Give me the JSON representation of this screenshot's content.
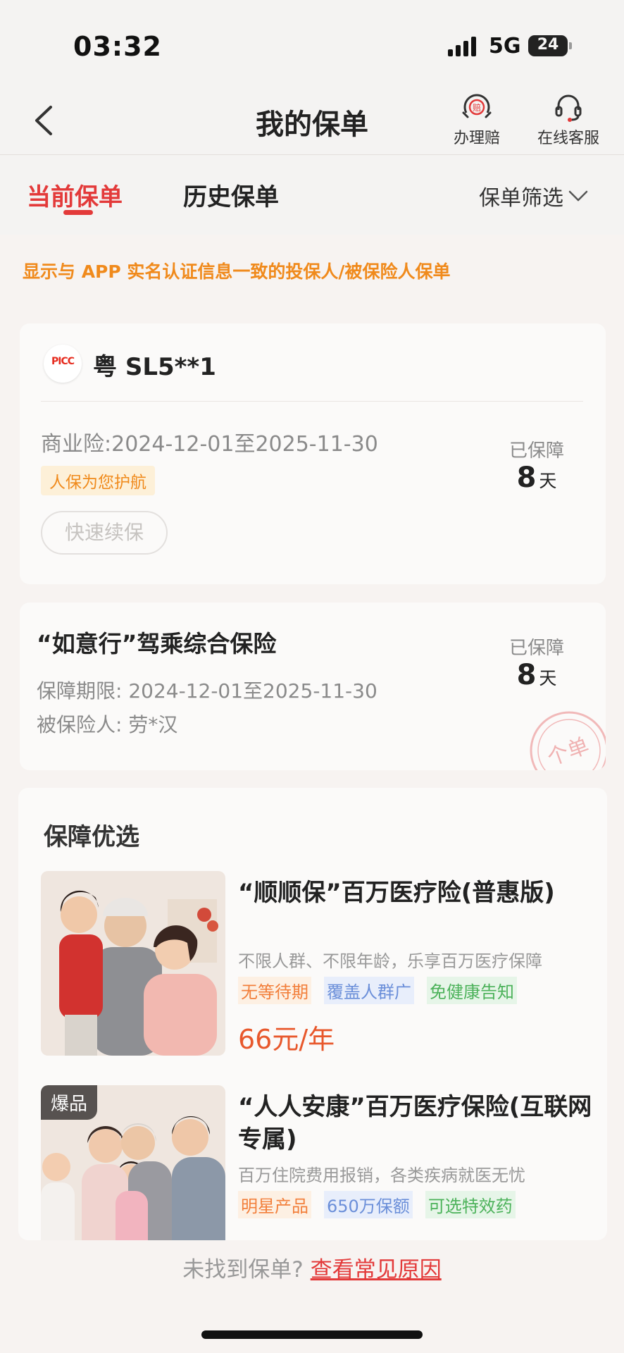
{
  "status_bar": {
    "time": "03:32",
    "network": "5G",
    "battery": "24"
  },
  "nav": {
    "title": "我的保单",
    "claim_label": "办理赔",
    "claim_icon_char": "赔",
    "service_label": "在线客服"
  },
  "tabs": {
    "current": "当前保单",
    "history": "历史保单",
    "filter": "保单筛选"
  },
  "notice": "显示与 APP 实名认证信息一致的投保人/被保险人保单",
  "policy_card": {
    "insurer_logo_text": "PICC",
    "plate": "粤 SL5**1",
    "range": "商业险:2024-12-01至2025-11-30",
    "tag": "人保为您护航",
    "renew": "快速续保",
    "protected_label": "已保障",
    "days": "8",
    "days_unit": "天"
  },
  "policy_card2": {
    "title": "“如意行”驾乘综合保险",
    "period": "保障期限: 2024-12-01至2025-11-30",
    "insured": "被保险人: 劳*汉",
    "protected_label": "已保障",
    "days": "8",
    "days_unit": "天",
    "stamp": "个单"
  },
  "recommend": {
    "title": "保障优选",
    "products": [
      {
        "name": "“顺顺保”百万医疗险(普惠版)",
        "desc": "不限人群、不限年龄，乐享百万医疗保障",
        "tags": [
          "无等待期",
          "覆盖人群广",
          "免健康告知"
        ],
        "price": "66元/年"
      },
      {
        "badge": "爆品",
        "name": "“人人安康”百万医疗保险(互联网专属)",
        "desc": "百万住院费用报销，各类疾病就医无忧",
        "tags": [
          "明星产品",
          "650万保额",
          "可选特效药"
        ]
      }
    ]
  },
  "footer": {
    "question": "未找到保单?",
    "link": "查看常见原因"
  },
  "colors": {
    "accent": "#e33a3a",
    "orange": "#f08a1c",
    "price": "#e8582c"
  }
}
